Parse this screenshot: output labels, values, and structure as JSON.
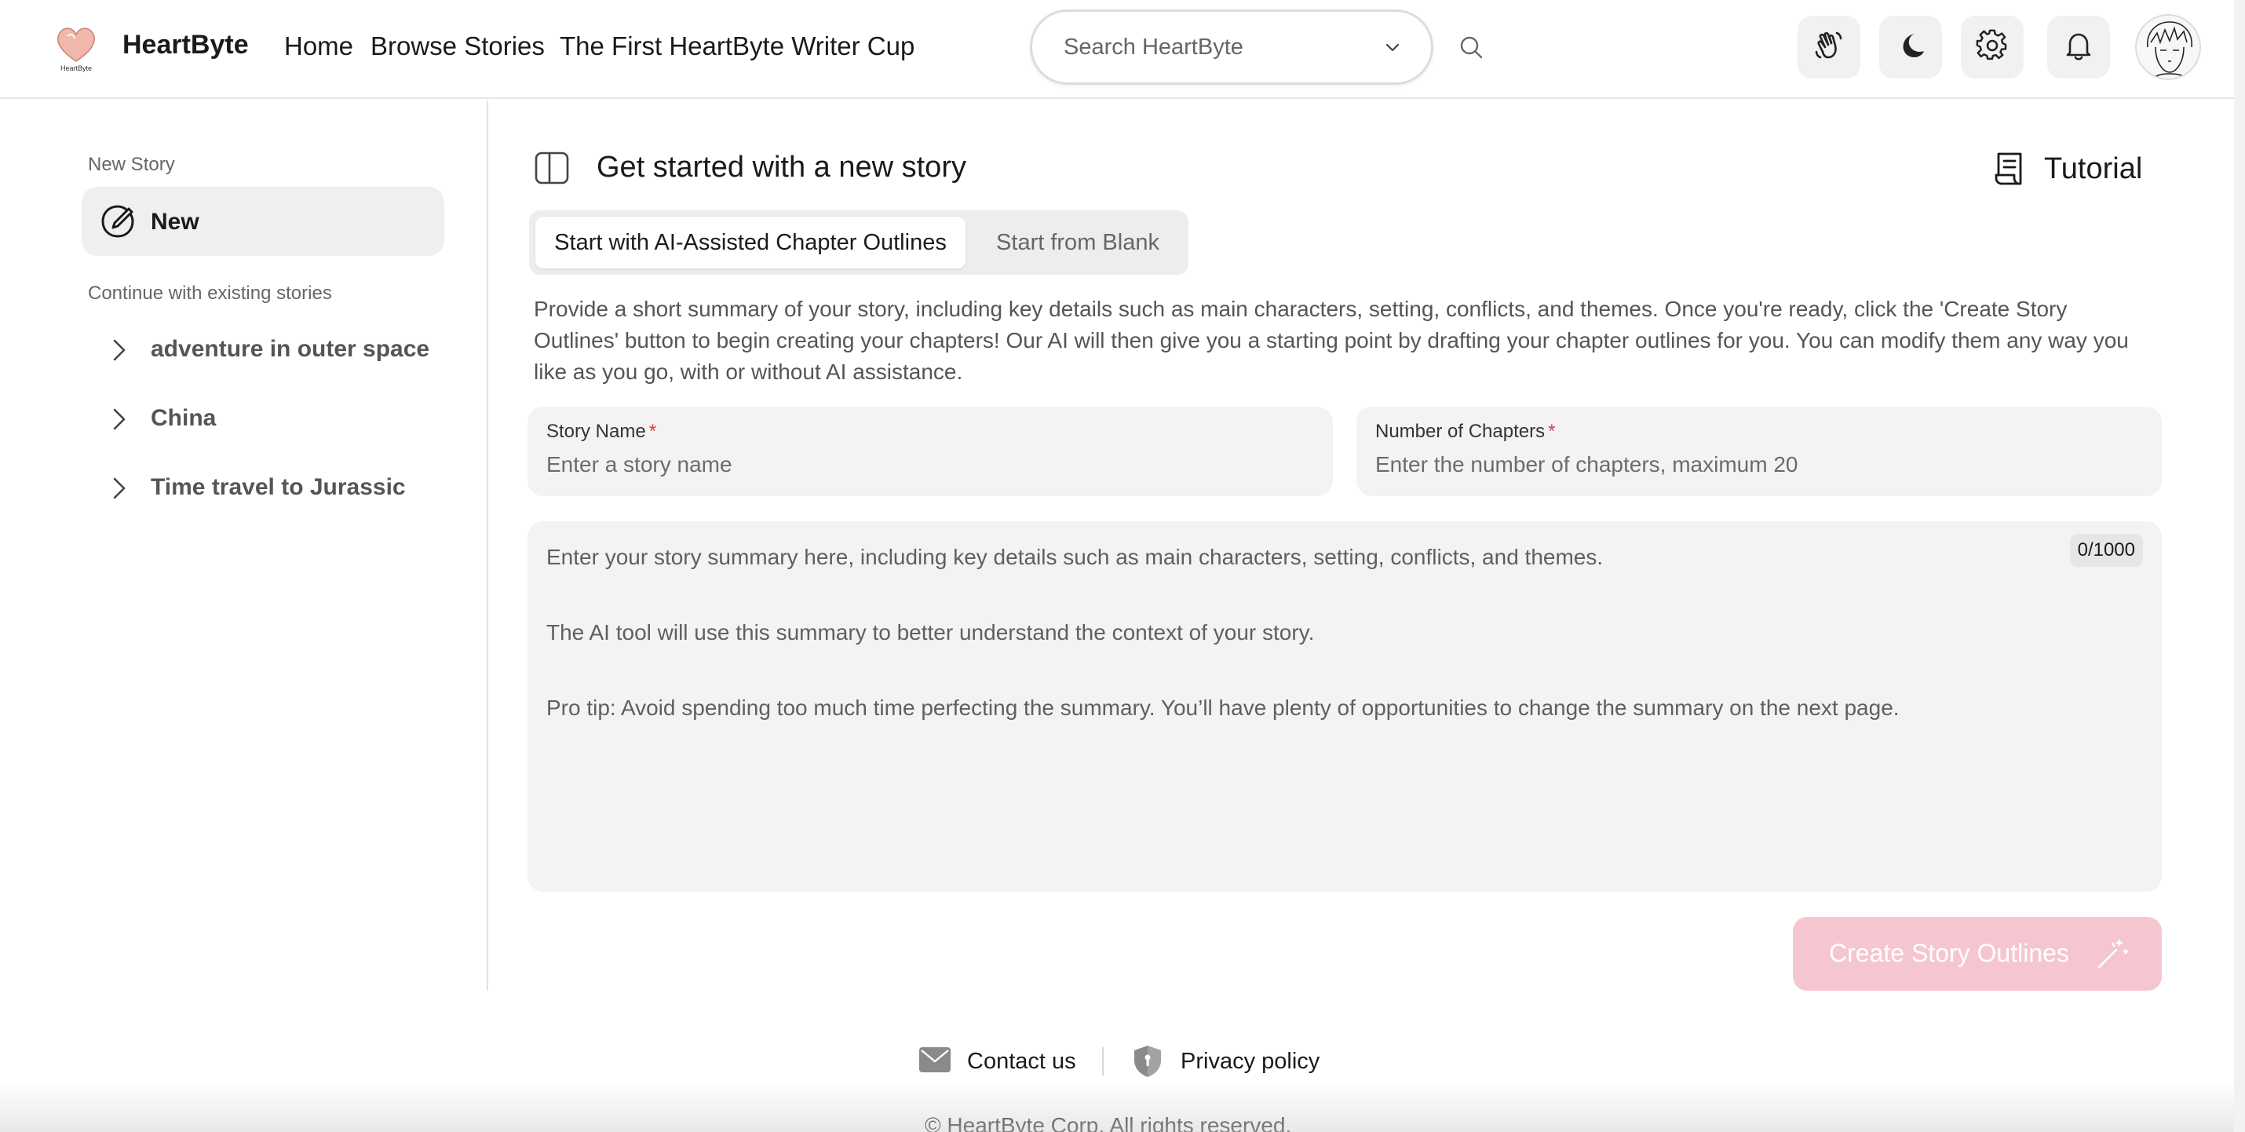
{
  "header": {
    "brand": "HeartByte",
    "logo_text": "HeartByte",
    "nav": [
      {
        "label": "Home"
      },
      {
        "label": "Browse Stories"
      },
      {
        "label": "The First HeartByte Writer Cup"
      }
    ],
    "search": {
      "placeholder": "Search HeartByte"
    },
    "icons": [
      "wave-hand-icon",
      "moon-icon",
      "gear-icon",
      "bell-icon"
    ]
  },
  "sidebar": {
    "new_section_label": "New Story",
    "new_item_label": "New",
    "existing_section_label": "Continue with existing stories",
    "stories": [
      {
        "label": "adventure in outer space"
      },
      {
        "label": "China"
      },
      {
        "label": "Time travel to Jurassic"
      }
    ]
  },
  "main": {
    "title": "Get started with a new story",
    "tutorial_label": "Tutorial",
    "tabs": [
      {
        "label": "Start with AI-Assisted Chapter Outlines",
        "active": true
      },
      {
        "label": "Start from Blank",
        "active": false
      }
    ],
    "intro": "Provide a short summary of your story, including key details such as main characters, setting, conflicts, and themes. Once you're ready, click the 'Create Story Outlines' button to begin creating your chapters! Our AI will then give you a starting point by drafting your chapter outlines for you. You can modify them any way you like as you go, with or without AI assistance.",
    "story_name": {
      "label": "Story Name",
      "required_mark": "*",
      "placeholder": "Enter a story name",
      "value": ""
    },
    "chapters": {
      "label": "Number of Chapters",
      "required_mark": "*",
      "placeholder": "Enter the number of chapters, maximum 20",
      "value": ""
    },
    "summary": {
      "placeholder": "Enter your story summary here, including key details such as main characters, setting, conflicts, and themes.\n\nThe AI tool will use this summary to better understand the context of your story.\n\nPro tip: Avoid spending too much time perfecting the summary. You’ll have plenty of opportunities to change the summary on the next page.",
      "value": "",
      "counter": "0/1000"
    },
    "create_button_label": "Create Story Outlines"
  },
  "footer": {
    "contact_label": "Contact us",
    "privacy_label": "Privacy policy",
    "copyright": "© HeartByte Corp. All rights reserved."
  },
  "colors": {
    "accent_disabled": "#f6c6d0",
    "required": "#e0384b",
    "field_bg": "#f3f3f3"
  }
}
